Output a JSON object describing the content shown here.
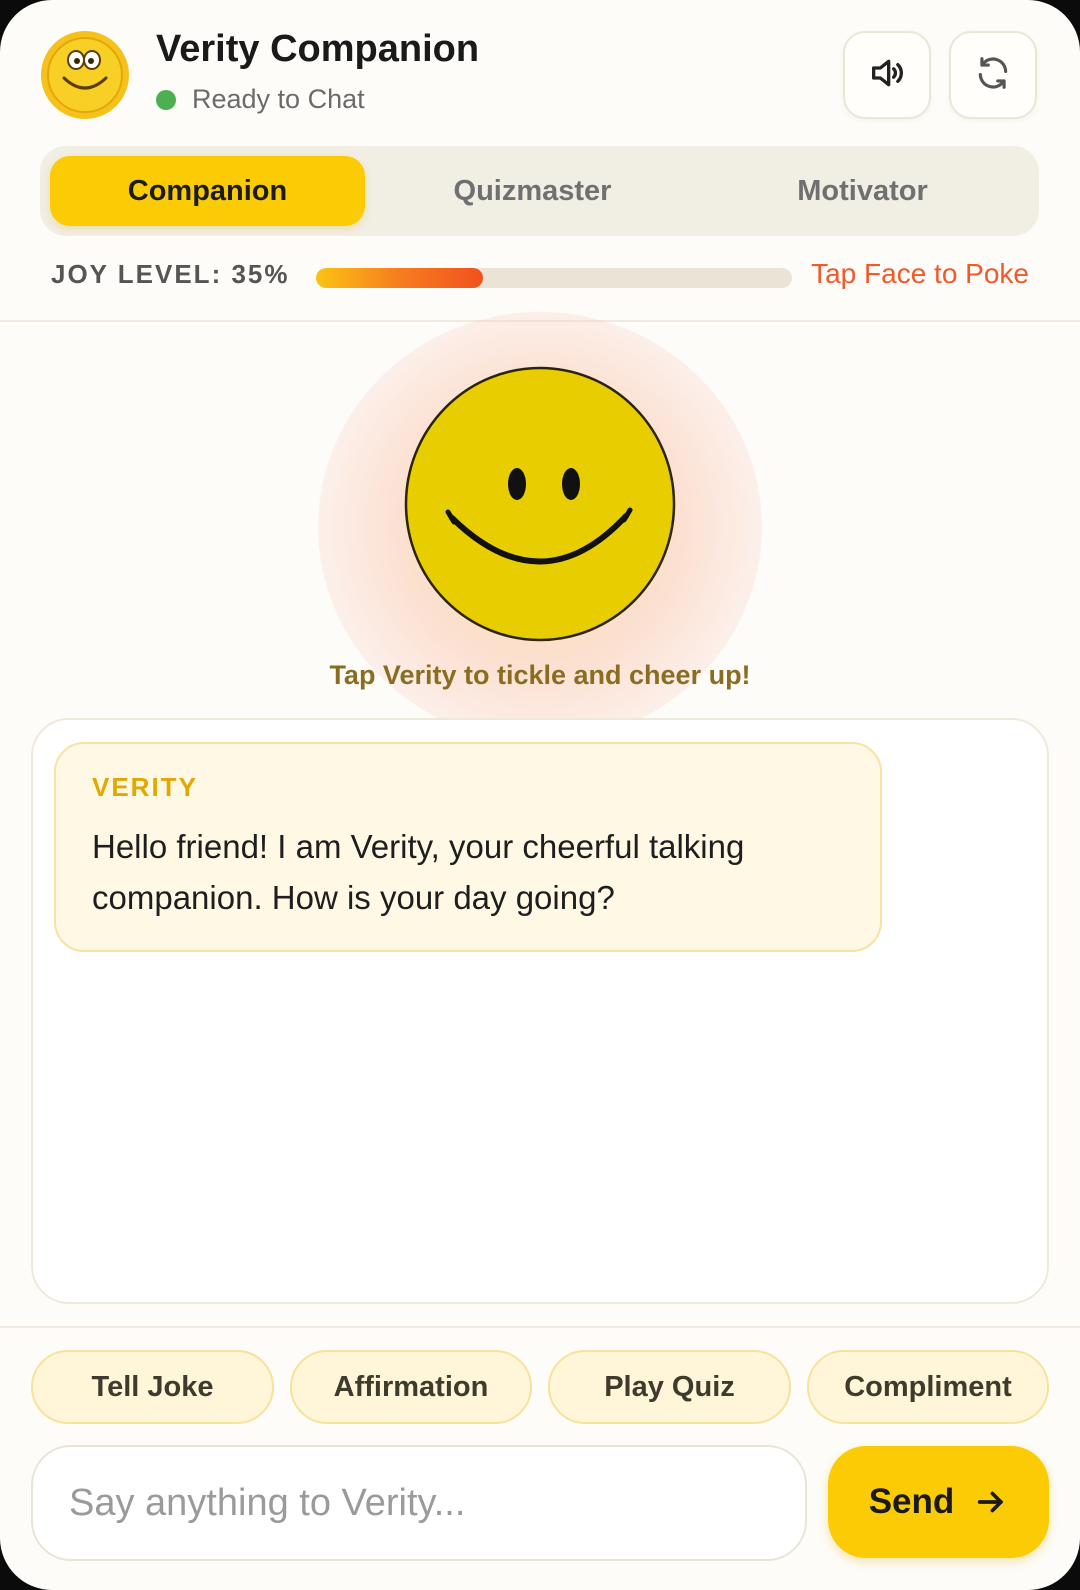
{
  "header": {
    "title": "Verity Companion",
    "status": "Ready to Chat",
    "status_color": "#4caf50"
  },
  "icons": {
    "avatar": "smiley-avatar-icon",
    "speaker": "speaker-volume-icon",
    "reset": "refresh-icon",
    "send": "arrow-right-icon"
  },
  "tabs": [
    {
      "label": "Companion",
      "active": true
    },
    {
      "label": "Quizmaster",
      "active": false
    },
    {
      "label": "Motivator",
      "active": false
    }
  ],
  "joy": {
    "label": "JOY LEVEL: 35%",
    "value": 0.35,
    "hint": "Tap Face to Poke"
  },
  "face": {
    "caption": "Tap Verity to tickle and cheer up!"
  },
  "chat": {
    "messages": [
      {
        "sender": "VERITY",
        "text": "Hello friend! I am Verity, your cheerful talking companion. How is your day going?"
      }
    ]
  },
  "quick_actions": [
    "Tell Joke",
    "Affirmation",
    "Play Quiz",
    "Compliment"
  ],
  "composer": {
    "placeholder": "Say anything to Verity...",
    "send_label": "Send"
  },
  "colors": {
    "accent": "#fbcb06",
    "background": "#fdfcf8",
    "hint": "#f05a2a",
    "sender": "#e3a800"
  }
}
